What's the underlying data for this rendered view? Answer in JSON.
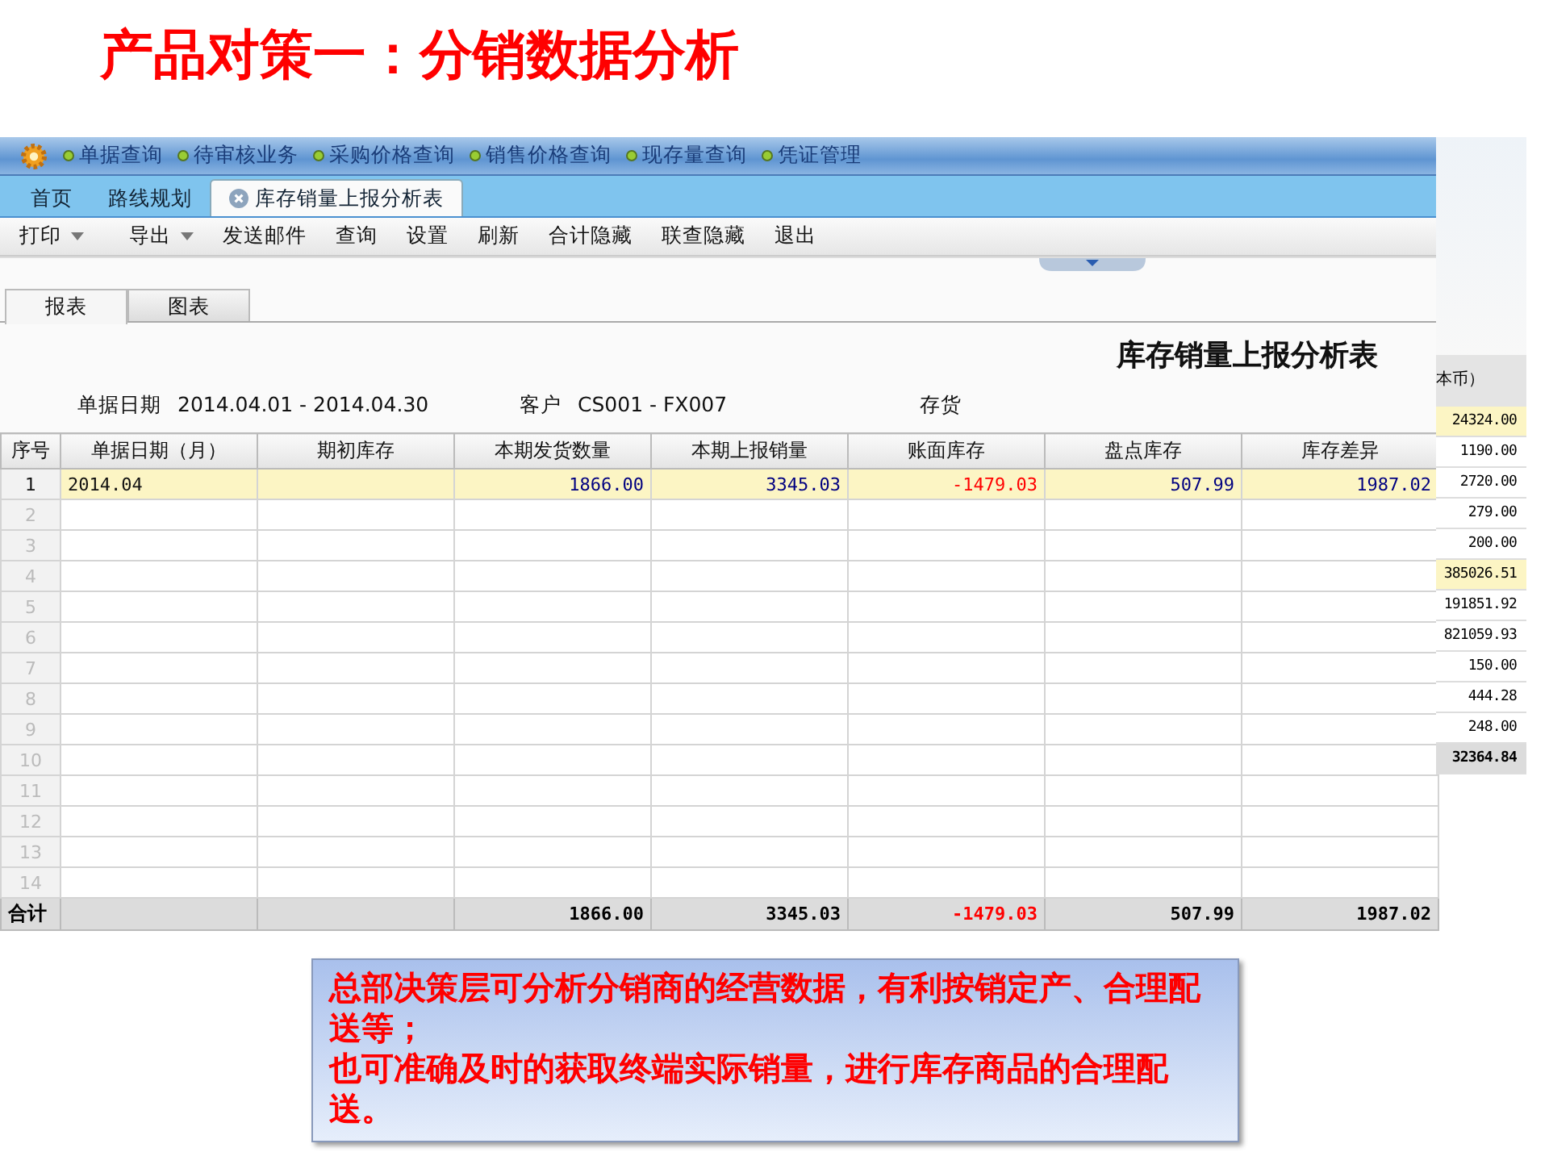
{
  "slide_title": "产品对策一：分销数据分析",
  "nav_links": [
    "单据查询",
    "待审核业务",
    "采购价格查询",
    "销售价格查询",
    "现存量查询",
    "凭证管理"
  ],
  "tabs": [
    {
      "label": "首页",
      "selected": false,
      "closable": false
    },
    {
      "label": "路线规划",
      "selected": false,
      "closable": false
    },
    {
      "label": "库存销量上报分析表",
      "selected": true,
      "closable": true
    }
  ],
  "toolbar": [
    {
      "label": "打印",
      "kind": "dropdown"
    },
    {
      "label": "导出",
      "kind": "dropdown"
    },
    {
      "label": "发送邮件",
      "kind": "button"
    },
    {
      "label": "查询",
      "kind": "button"
    },
    {
      "label": "设置",
      "kind": "button"
    },
    {
      "label": "刷新",
      "kind": "button"
    },
    {
      "label": "合计隐藏",
      "kind": "button"
    },
    {
      "label": "联查隐藏",
      "kind": "button"
    },
    {
      "label": "退出",
      "kind": "button"
    }
  ],
  "view_tabs": [
    {
      "label": "报表",
      "selected": true
    },
    {
      "label": "图表",
      "selected": false
    }
  ],
  "report_title": "库存销量上报分析表",
  "filters": [
    {
      "label": "单据日期",
      "value": "2014.04.01 - 2014.04.30"
    },
    {
      "label": "客户",
      "value": "CS001 - FX007"
    },
    {
      "label": "存货"
    }
  ],
  "table": {
    "columns": [
      "序号",
      "单据日期（月）",
      "期初库存",
      "本期发货数量",
      "本期上报销量",
      "账面库存",
      "盘点库存",
      "库存差异"
    ],
    "rows": [
      {
        "seq": "1",
        "cells": [
          {
            "text": "2014.04",
            "negative": false
          },
          null,
          {
            "text": "1866.00",
            "negative": false
          },
          {
            "text": "3345.03",
            "negative": false
          },
          {
            "text": "-1479.03",
            "negative": true
          },
          {
            "text": "507.99",
            "negative": false
          },
          {
            "text": "1987.02",
            "negative": false
          }
        ]
      },
      {
        "seq": "2"
      },
      {
        "seq": "3"
      },
      {
        "seq": "4"
      },
      {
        "seq": "5"
      },
      {
        "seq": "6"
      },
      {
        "seq": "7"
      },
      {
        "seq": "8"
      },
      {
        "seq": "9"
      },
      {
        "seq": "10"
      },
      {
        "seq": "11"
      },
      {
        "seq": "12"
      },
      {
        "seq": "13"
      },
      {
        "seq": "14"
      }
    ],
    "total": {
      "label": "合计",
      "cells": [
        null,
        null,
        {
          "text": "1866.00",
          "negative": false
        },
        {
          "text": "3345.03",
          "negative": false
        },
        {
          "text": "-1479.03",
          "negative": true
        },
        {
          "text": "507.99",
          "negative": false
        },
        {
          "text": "1987.02",
          "negative": false
        }
      ]
    }
  },
  "background_window": {
    "column_header": "本币）",
    "values": [
      {
        "text": "24324.00",
        "selected": true
      },
      {
        "text": "1190.00",
        "selected": false
      },
      {
        "text": "2720.00",
        "selected": false
      },
      {
        "text": "279.00",
        "selected": false
      },
      {
        "text": "200.00",
        "selected": false
      },
      {
        "text": "385026.51",
        "selected": true
      },
      {
        "text": "191851.92",
        "selected": false
      },
      {
        "text": "821059.93",
        "selected": false
      },
      {
        "text": "150.00",
        "selected": false
      },
      {
        "text": "444.28",
        "selected": false
      },
      {
        "text": "248.00",
        "selected": false
      }
    ],
    "total": "32364.84"
  },
  "callout": [
    "总部决策层可分析分销商的经营数据，有利按销定产、合理配送等；",
    "也可准确及时的获取终端实际销量，进行库存商品的合理配送。"
  ]
}
